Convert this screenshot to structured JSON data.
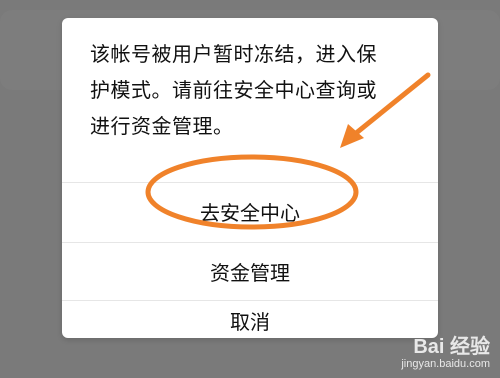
{
  "dialog": {
    "message_lines": [
      "该帐号被用户暂时冻结，进入保",
      "护模式。请前往安全中心查询或",
      "进行资金管理。"
    ],
    "options": [
      {
        "label": "去安全中心"
      },
      {
        "label": "资金管理"
      },
      {
        "label": "取消"
      }
    ]
  },
  "annotation": {
    "highlight_color": "#f0822a"
  },
  "watermark": {
    "logo": "Bai 经验",
    "url": "jingyan.baidu.com"
  }
}
